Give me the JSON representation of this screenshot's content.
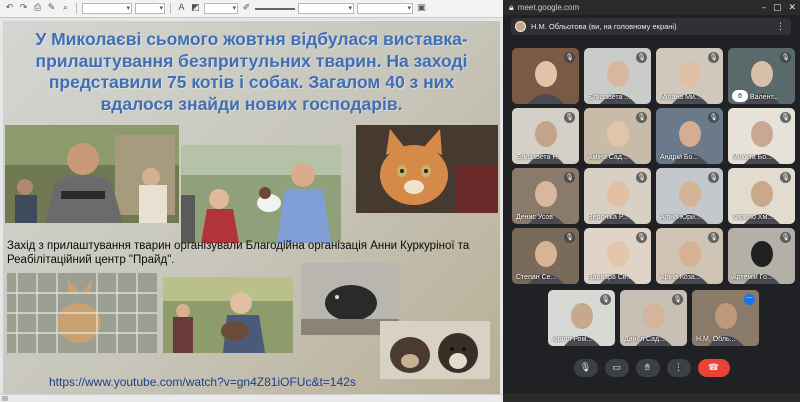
{
  "toolbar": {
    "font_name": "",
    "font_size": "",
    "style_box": "",
    "line_box": ""
  },
  "slide": {
    "title": "У Миколаєві сьомого жовтня відбулася виставка-прилаштування безпритульних тварин. На заході представили 75 котів і собак. Загалом 40 з них вдалося знайди нових господарів.",
    "body": "Захід з прилаштування тварин організували Благодійна організація Анни Куркуріної та Реабілітаційний центр \"Прайд\".",
    "link": "https://www.youtube.com/watch?v=gn4Z81iOFUc&t=142s"
  },
  "meet": {
    "url": "meet.google.com",
    "presenter": "Н.М. Обльотова (ви, на головному екрані)",
    "participants": [
      {
        "name": "",
        "id": "p0"
      },
      {
        "name": "Єлизавета ...",
        "id": "p1"
      },
      {
        "name": "Мілана Ми...",
        "id": "p2"
      },
      {
        "name": "Валент...",
        "id": "p3"
      },
      {
        "name": "Єлизавета Р...",
        "id": "p4"
      },
      {
        "name": "Аміна Сад...",
        "id": "p5"
      },
      {
        "name": "Андрій Бо...",
        "id": "p6"
      },
      {
        "name": "Микита Бо...",
        "id": "p7"
      },
      {
        "name": "Денис Усов",
        "id": "p8"
      },
      {
        "name": "Вероніка Р...",
        "id": "p9"
      },
      {
        "name": "Аліна Юри...",
        "id": "p10"
      },
      {
        "name": "Кирило Хм...",
        "id": "p11"
      },
      {
        "name": "Степан Се...",
        "id": "p12"
      },
      {
        "name": "Варвара Св...",
        "id": "p13"
      },
      {
        "name": "Аріна Коза...",
        "id": "p14"
      },
      {
        "name": "Артемій Го...",
        "id": "p15"
      },
      {
        "name": "Кірілл Ром...",
        "id": "p16"
      },
      {
        "name": "Даніїл Сад...",
        "id": "p17"
      },
      {
        "name": "Н.М. Обль...",
        "id": "p18"
      }
    ]
  },
  "icons": {
    "mic": "microphone-icon",
    "camera": "camera-icon",
    "hand": "raise-hand-icon",
    "more": "more-options-icon",
    "end_call": "end-call-icon"
  },
  "colors": {
    "title_blue": "#3f6fb6",
    "meet_bg": "#202124",
    "end_call": "#ea4335",
    "active_outline": "#8ab4f8"
  }
}
